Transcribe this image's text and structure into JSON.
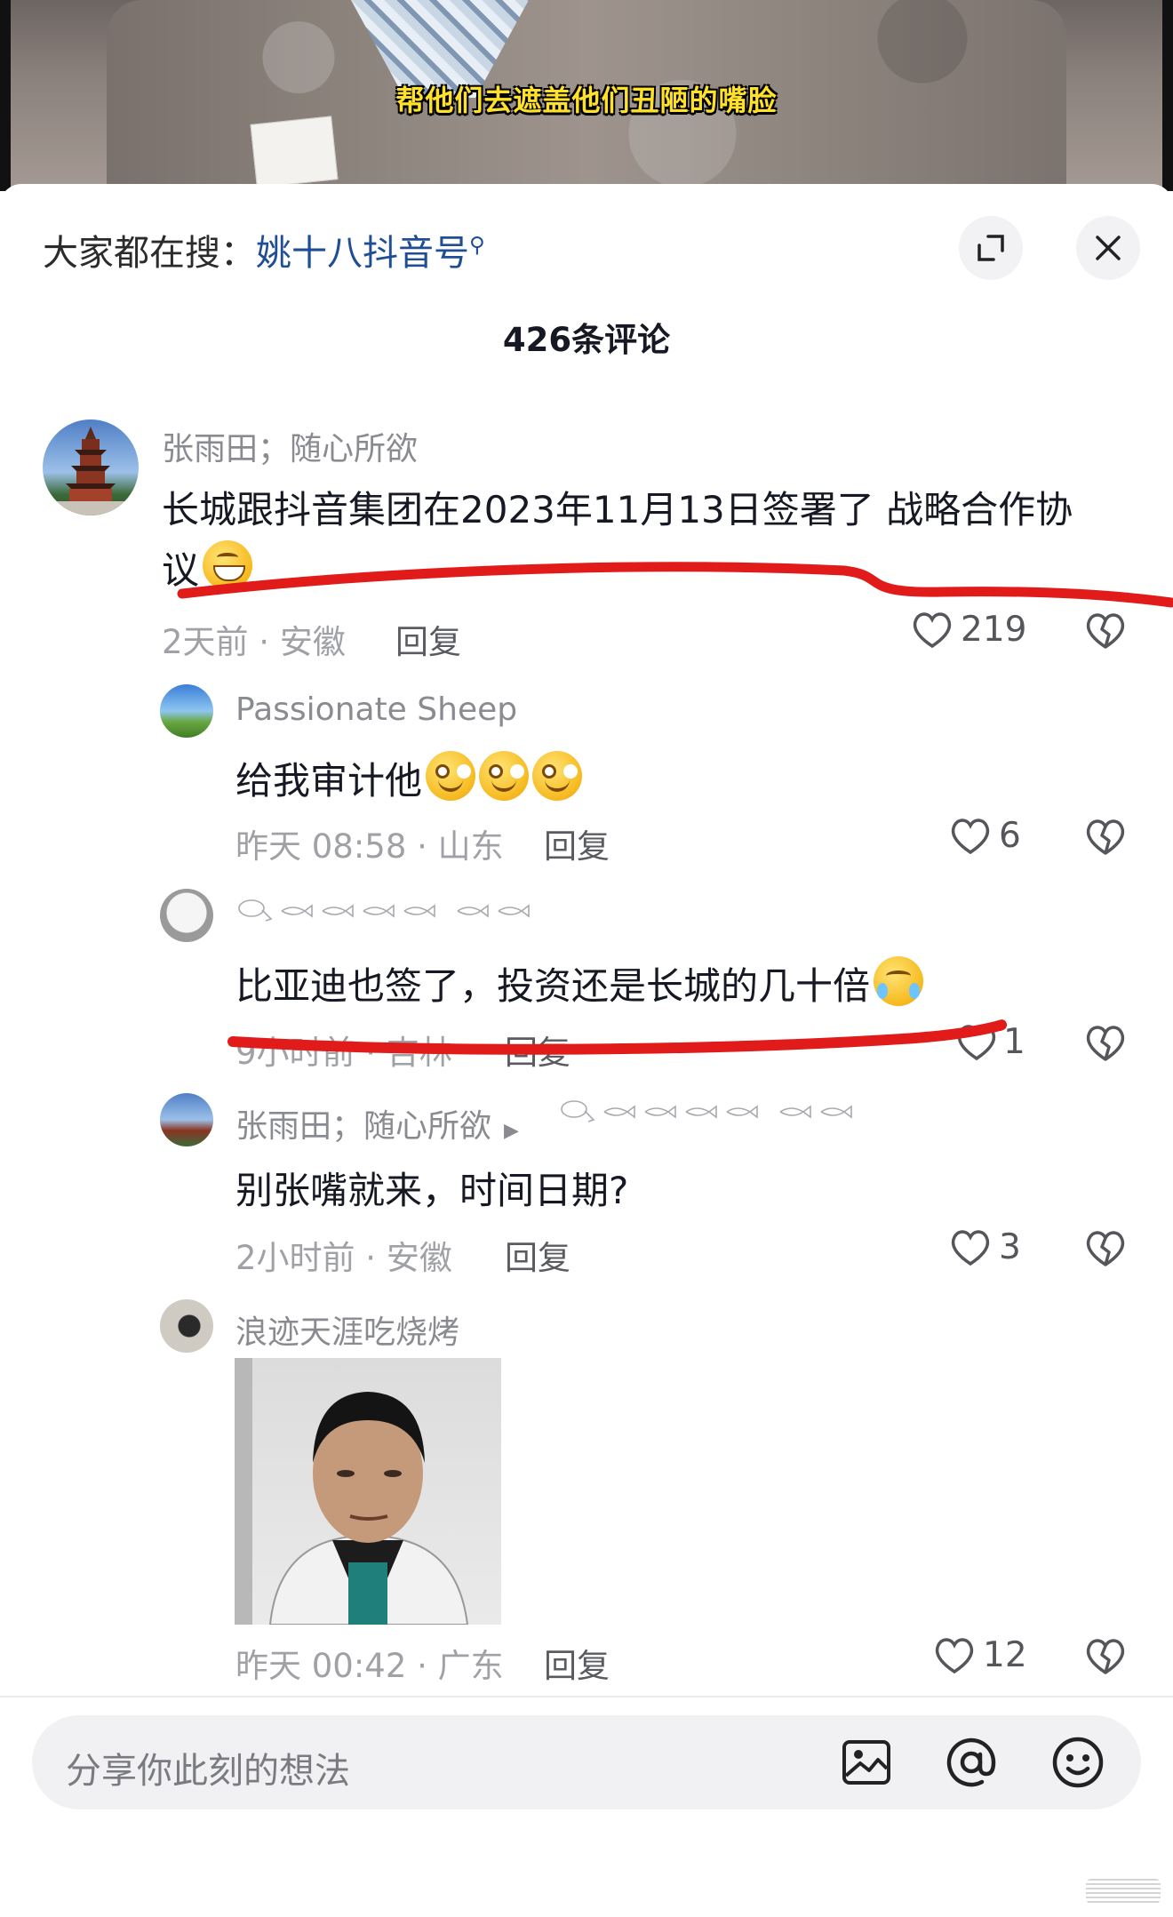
{
  "video": {
    "caption": "帮他们去遮盖他们丑陋的嘴脸"
  },
  "header": {
    "search_prefix": "大家都在搜：",
    "search_keyword": "姚十八抖音号",
    "search_icon": "magnifier-icon",
    "expand_icon": "expand-icon",
    "close_icon": "close-icon",
    "comment_count": "426条评论"
  },
  "comments": [
    {
      "user": "张雨田；随心所欲",
      "text": "长城跟抖音集团在2023年11月13日签署了 战略合作协",
      "text_line2": "议",
      "emoji": "grin-emoji",
      "meta": "2天前 · 安徽",
      "reply_label": "回复",
      "likes": "219"
    },
    {
      "user": "Passionate Sheep",
      "text": "给我审计他",
      "emoji": "smile-emoji",
      "meta": "昨天 08:58 · 山东",
      "reply_label": "回复",
      "likes": "6"
    },
    {
      "user": "",
      "text": "比亚迪也签了，投资还是长城的几十倍",
      "emoji": "cry-emoji",
      "meta": "9小时前 · 吉林",
      "reply_label": "回复",
      "likes": "1"
    },
    {
      "user": "张雨田；随心所欲",
      "text": "别张嘴就来，时间日期?",
      "meta": "2小时前 · 安徽",
      "reply_label": "回复",
      "likes": "3"
    },
    {
      "user": "浪迹天涯吃烧烤",
      "image": "photo-of-man",
      "meta": "昨天 00:42 · 广东",
      "reply_label": "回复",
      "likes": "12"
    }
  ],
  "input": {
    "placeholder": "分享你此刻的想法",
    "icons": [
      "image-icon",
      "at-icon",
      "emoji-icon"
    ]
  },
  "colors": {
    "keyword": "#1f4e95",
    "annotation_red": "#e11a1a",
    "caption_yellow": "#ffe02b"
  }
}
